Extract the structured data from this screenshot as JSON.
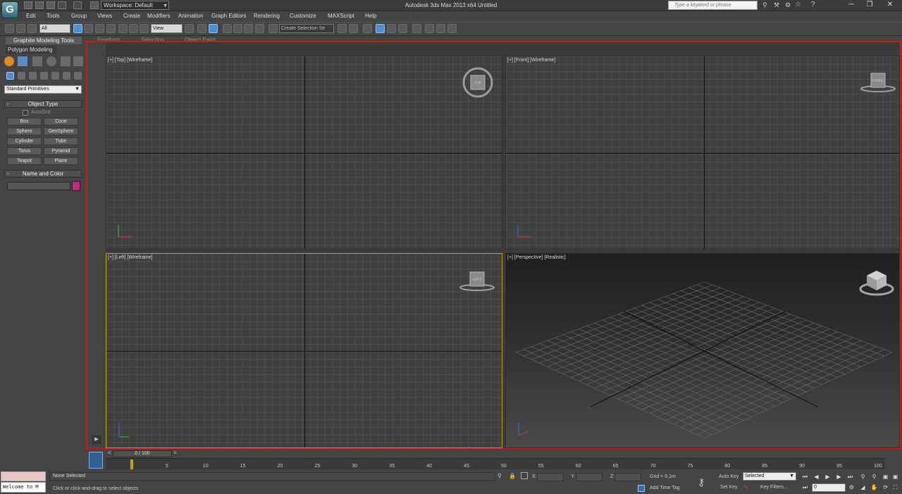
{
  "colors": {
    "selection_border": "#c91a1a",
    "active_viewport": "#b8a000",
    "name_color": "#c62a7a",
    "app_logo": "#4d8f99"
  },
  "titlebar": {
    "app_logo_glyph": "G",
    "workspace_label": "Workspace: Default",
    "title": "Autodesk 3ds Max  2013 x64     Untitled",
    "search_placeholder": "Type a keyword or phrase"
  },
  "menu": [
    "Edit",
    "Tools",
    "Group",
    "Views",
    "Create",
    "Modifiers",
    "Animation",
    "Graph Editors",
    "Rendering",
    "Customize",
    "MAXScript",
    "Help"
  ],
  "toolbar": {
    "filter_value": "All",
    "ref_coord_value": "View",
    "selection_set_value": "Create Selection Se"
  },
  "ribbon": {
    "tabs": [
      "Graphite Modeling Tools",
      "Freeform",
      "Selection",
      "Object Paint"
    ],
    "panel_label": "Polygon Modeling"
  },
  "command_panel": {
    "category": "Standard Primitives",
    "object_type_title": "Object Type",
    "autogrid_label": "AutoGrid",
    "buttons": [
      "Box",
      "Cone",
      "Sphere",
      "GeoSphere",
      "Cylinder",
      "Tube",
      "Torus",
      "Pyramid",
      "Teapot",
      "Plane"
    ],
    "name_color_title": "Name and Color"
  },
  "viewports": [
    {
      "label": "[+] [Top] [Wireframe]",
      "cube_label": "TOP"
    },
    {
      "label": "[+] [Front] [Wireframe]",
      "cube_label": "FRONT"
    },
    {
      "label": "[+] [Left] [Wireframe]",
      "cube_label": "LEFT"
    },
    {
      "label": "[+] [Perspective] [Realistic]",
      "cube_label": ""
    }
  ],
  "timeline": {
    "slider_label": "0 / 100",
    "ticks": [
      "5",
      "10",
      "15",
      "20",
      "25",
      "30",
      "35",
      "40",
      "45",
      "50",
      "55",
      "60",
      "65",
      "70",
      "75",
      "80",
      "85",
      "90",
      "95",
      "100"
    ],
    "current_frame": "0"
  },
  "status": {
    "maxscript_text": "Welcome to M",
    "selection_status": "None Selected",
    "prompt": "Click or click-and-drag to select objects",
    "x_label": "X:",
    "y_label": "Y:",
    "z_label": "Z:",
    "grid": "Grid = 0,1m",
    "add_time_tag": "Add Time Tag",
    "auto_key": "Auto Key",
    "set_key": "Set Key",
    "key_mode_value": "Selected",
    "key_filters": "Key Filters..."
  }
}
